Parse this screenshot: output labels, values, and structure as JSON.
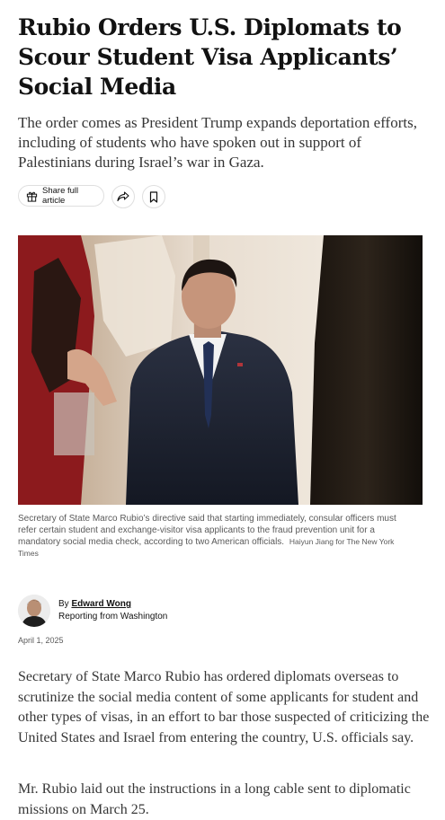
{
  "article": {
    "headline": "Rubio Orders U.S. Diplomats to Scour Student Visa Applicants’ Social Media",
    "summary": "The order comes as President Trump expands deportation efforts, including of students who have spoken out in support of Palestinians during Israel’s war in Gaza.",
    "actions": {
      "share_full_label": "Share full article",
      "share_icon": "share-arrow-icon",
      "save_icon": "bookmark-icon"
    },
    "photo": {
      "caption": "Secretary of State Marco Rubio’s directive said that starting immediately, consular officers must refer certain student and exchange-visitor visa applicants to the fraud prevention unit for a mandatory social media check, according to two American officials.",
      "credit": "Haiyun Jiang for The New York Times"
    },
    "byline": {
      "prefix": "By",
      "author": "Edward Wong",
      "location": "Reporting from Washington",
      "date": "April 1, 2025"
    },
    "body": [
      "Secretary of State Marco Rubio has ordered diplomats overseas to scrutinize the social media content of some applicants for student and other types of visas, in an effort to bar those suspected of criticizing the United States and Israel from entering the country, U.S. officials say.",
      "Mr. Rubio laid out the instructions in a long cable sent to diplomatic missions on March 25."
    ]
  }
}
